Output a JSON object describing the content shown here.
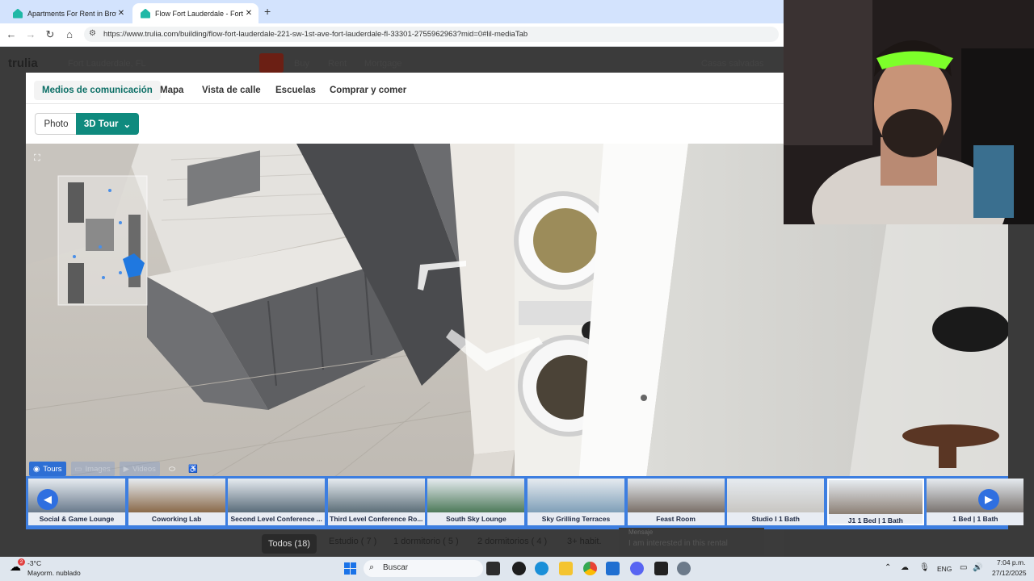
{
  "browser": {
    "tabs": [
      {
        "title": "Apartments For Rent in Browar",
        "active": false
      },
      {
        "title": "Flow Fort Lauderdale - Fort La",
        "active": true
      }
    ],
    "new_tab": "+",
    "url": "https://www.trulia.com/building/flow-fort-lauderdale-221-sw-1st-ave-fort-lauderdale-fl-33301-2755962963?mid=0#lil-mediaTab"
  },
  "background_page": {
    "logo": "trulia",
    "search_value": "Fort Lauderdale, FL",
    "nav": [
      "Buy",
      "Rent",
      "Mortgage"
    ],
    "saved": "Casas salvadas",
    "filters": {
      "all": "Todos (18)",
      "studio": "Estudio ( 7 )",
      "one_bed": "1 dormitorio ( 5 )",
      "two_bed": "2 dormitorios ( 4 )",
      "three_plus": "3+ habit."
    },
    "message_text": "I am interested in this rental",
    "message_label": "Mensaje"
  },
  "modal": {
    "tabs": [
      "Medios de comunicación",
      "Mapa",
      "Vista de calle",
      "Escuelas",
      "Comprar y comer"
    ],
    "selected_tab": "Medios de comunicación",
    "photo_button": "Photo",
    "tour_button": "3D Tour"
  },
  "viewer": {
    "tour_tabs": [
      "Tours",
      "Images",
      "Videos"
    ],
    "selected_tour_tab": "Tours",
    "thumbnails": [
      "Social & Game Lounge",
      "Coworking Lab",
      "Second Level Conference ...",
      "Third Level Conference Ro...",
      "South Sky Lounge",
      "Sky Grilling Terraces",
      "Feast Room",
      "Studio I 1 Bath",
      "J1 1 Bed | 1 Bath",
      "1 Bed | 1 Bath"
    ],
    "selected_thumbnail": "J1 1 Bed | 1 Bath"
  },
  "taskbar": {
    "weather_temp": "-3°C",
    "weather_desc": "Mayorm. nublado",
    "weather_badge": "2",
    "search_label": "Buscar",
    "lang": "ENG",
    "time": "7:04 p.m.",
    "date": "27/12/2025"
  },
  "colors": {
    "accent_teal": "#0f8a7e",
    "tour_blue": "#3d7ee0",
    "tab_bar": "#d3e3fd"
  }
}
